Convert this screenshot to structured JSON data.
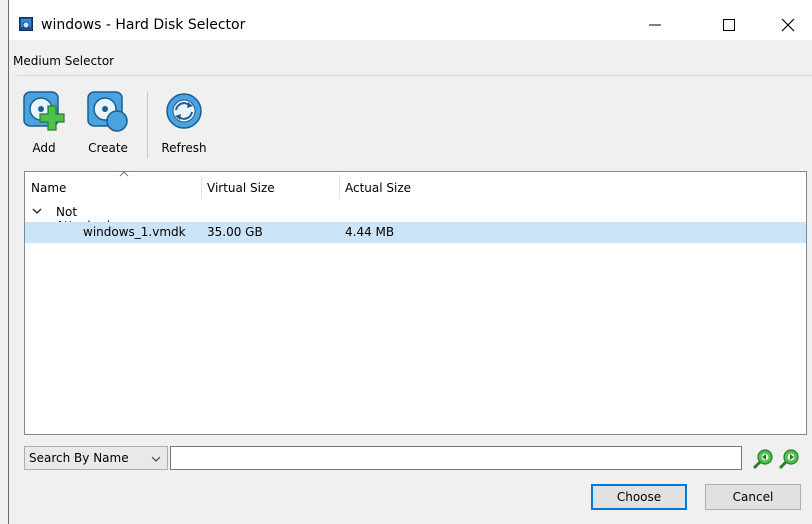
{
  "window": {
    "title": "windows - Hard Disk Selector"
  },
  "menu": {
    "label": "Medium Selector"
  },
  "toolbar": {
    "add": "Add",
    "create": "Create",
    "refresh": "Refresh"
  },
  "table": {
    "columns": [
      "Name",
      "Virtual Size",
      "Actual Size"
    ],
    "groups": [
      {
        "label": "Not Attached",
        "rows": [
          {
            "name": "windows_1.vmdk",
            "virtual_size": "35.00 GB",
            "actual_size": "4.44 MB"
          }
        ]
      }
    ]
  },
  "search": {
    "mode": "Search By Name",
    "value": ""
  },
  "buttons": {
    "choose": "Choose",
    "cancel": "Cancel"
  },
  "colors": {
    "selection": "#cce4f7",
    "focus": "#0078d7",
    "accent_green": "#4cc24c",
    "disk_blue": "#4aa3df"
  }
}
